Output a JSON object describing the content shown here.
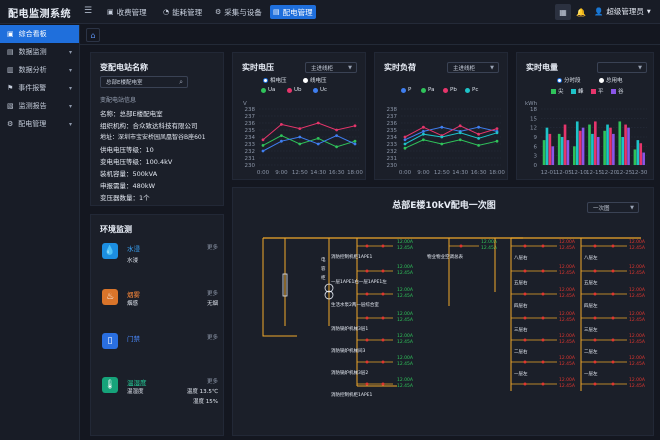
{
  "app": {
    "title": "配电监测系统",
    "user": "超级管理员"
  },
  "topnav": [
    {
      "icon": "billing-icon",
      "label": "收费管理",
      "active": false
    },
    {
      "icon": "energy-icon",
      "label": "能耗管理",
      "active": false
    },
    {
      "icon": "device-icon",
      "label": "采集与设备",
      "active": false
    },
    {
      "icon": "distribution-icon",
      "label": "配电管理",
      "active": true
    }
  ],
  "sidebar": [
    {
      "label": "综合看板",
      "active": true,
      "has_arrow": false
    },
    {
      "label": "数据监测",
      "active": false,
      "has_arrow": true
    },
    {
      "label": "数据分析",
      "active": false,
      "has_arrow": true
    },
    {
      "label": "事件报警",
      "active": false,
      "has_arrow": true
    },
    {
      "label": "监测报告",
      "active": false,
      "has_arrow": true
    },
    {
      "label": "配电管理",
      "active": false,
      "has_arrow": true
    }
  ],
  "station": {
    "title": "变配电站名称",
    "selected": "总部E楼配电室",
    "info_title": "变配电站信息",
    "lines": [
      "名称：总部E楼配电室",
      "组织机构：合众致达科技有限公司",
      "地址：深圳市宝安桥园凤凰智谷B座601",
      "供电电压等级：10",
      "变电电压等级：100.4kV",
      "装机容量：500kVA",
      "申报需量：480kW",
      "变压器数量：1个"
    ]
  },
  "environment": {
    "title": "环境监测",
    "items": [
      {
        "icon": "water-icon",
        "name": "水浸",
        "color": "#1c8ee0",
        "name_color": "#3aa8ff",
        "more": "更多",
        "sub": "水浸",
        "value": ""
      },
      {
        "icon": "smoke-icon",
        "name": "烟雾",
        "color": "#d9742a",
        "name_color": "#ff8a3a",
        "more": "更多",
        "sub": "烟感",
        "value": "无烟"
      },
      {
        "icon": "door-icon",
        "name": "门禁",
        "color": "#2a6fe0",
        "name_color": "#4a8aff",
        "more": "更多",
        "sub": "",
        "value": ""
      },
      {
        "icon": "thermometer-icon",
        "name": "温湿度",
        "color": "#16a37a",
        "name_color": "#25d09a",
        "more": "更多",
        "sub": "温湿度",
        "value": "温度 13.5℃",
        "value2": "湿度 15%"
      }
    ]
  },
  "voltage": {
    "title": "实时电压",
    "select": "主进线柜",
    "radio": [
      "相电压",
      "线电压"
    ],
    "legend": [
      {
        "name": "Ua",
        "color": "#2fc35a"
      },
      {
        "name": "Ub",
        "color": "#e6356b"
      },
      {
        "name": "Uc",
        "color": "#3f7ef0"
      }
    ],
    "unit": "V"
  },
  "load": {
    "title": "实时负荷",
    "select": "主进线柜",
    "legend": [
      {
        "name": "P",
        "color": "#3f7ef0"
      },
      {
        "name": "Pa",
        "color": "#2fc35a"
      },
      {
        "name": "Pb",
        "color": "#e6356b"
      },
      {
        "name": "Pc",
        "color": "#1ec3c8"
      }
    ]
  },
  "energy": {
    "title": "实时电量",
    "select": "",
    "radio": [
      "分时段",
      "总用电"
    ],
    "legend": [
      {
        "name": "尖",
        "color": "#2fc35a"
      },
      {
        "name": "峰",
        "color": "#1ec3c8"
      },
      {
        "name": "平",
        "color": "#e6356b"
      },
      {
        "name": "谷",
        "color": "#8a55e8"
      }
    ],
    "unit": "kWh"
  },
  "diagram": {
    "title": "总部E楼10kV配电一次图",
    "select": "一次图"
  },
  "chart_data": [
    {
      "type": "line",
      "title": "实时电压",
      "ylabel": "V",
      "x": [
        "0:00",
        "9:00",
        "12:50",
        "14:30",
        "16:30",
        "18:00"
      ],
      "ylim": [
        230,
        238
      ],
      "yticks": [
        230,
        231,
        232,
        233,
        234,
        235,
        236,
        237,
        238
      ],
      "series": [
        {
          "name": "Ua",
          "color": "#2fc35a",
          "values": [
            232.8,
            234.2,
            233.0,
            233.8,
            232.6,
            233.4
          ]
        },
        {
          "name": "Ub",
          "color": "#e6356b",
          "values": [
            233.6,
            235.8,
            235.2,
            236.0,
            235.0,
            235.6
          ]
        },
        {
          "name": "Uc",
          "color": "#3f7ef0",
          "values": [
            232.0,
            233.4,
            234.0,
            233.0,
            234.2,
            233.0
          ]
        }
      ]
    },
    {
      "type": "line",
      "title": "实时负荷",
      "ylabel": "",
      "x": [
        "0:00",
        "9:00",
        "12:50",
        "14:30",
        "16:30",
        "18:00"
      ],
      "ylim": [
        230,
        238
      ],
      "yticks": [
        230,
        231,
        232,
        233,
        234,
        235,
        236,
        237,
        238
      ],
      "series": [
        {
          "name": "P",
          "color": "#3f7ef0",
          "values": [
            233.6,
            234.8,
            235.4,
            234.8,
            235.4,
            234.8
          ]
        },
        {
          "name": "Pa",
          "color": "#2fc35a",
          "values": [
            232.4,
            233.6,
            233.0,
            233.6,
            232.8,
            233.4
          ]
        },
        {
          "name": "Pb",
          "color": "#e6356b",
          "values": [
            234.0,
            235.4,
            234.2,
            235.6,
            234.4,
            235.2
          ]
        },
        {
          "name": "Pc",
          "color": "#1ec3c8",
          "values": [
            233.0,
            234.4,
            234.0,
            234.6,
            233.8,
            234.6
          ]
        }
      ]
    },
    {
      "type": "bar",
      "title": "实时电量",
      "ylabel": "kWh",
      "categories": [
        "12-01",
        "12-05",
        "12-10",
        "12-15",
        "12-20",
        "12-25",
        "12-30"
      ],
      "ylim": [
        0,
        18
      ],
      "yticks": [
        0,
        3,
        6,
        9,
        12,
        15,
        18
      ],
      "series": [
        {
          "name": "尖",
          "color": "#2fc35a",
          "values": [
            8,
            10,
            6,
            13,
            11,
            14,
            5
          ]
        },
        {
          "name": "峰",
          "color": "#1ec3c8",
          "values": [
            12,
            9,
            14,
            10,
            13,
            9,
            8
          ]
        },
        {
          "name": "平",
          "color": "#e6356b",
          "values": [
            10,
            13,
            11,
            14,
            12,
            13,
            7
          ]
        },
        {
          "name": "谷",
          "color": "#8a55e8",
          "values": [
            6,
            8,
            12,
            9,
            10,
            12,
            4
          ]
        }
      ]
    }
  ],
  "single_line": {
    "left_vertical": [
      "电容柜",
      "主进线柜"
    ],
    "col1": [
      "消防控制机柜1APE1",
      "一层1APE1右一层1APE1左",
      "生活水泵2两一层综合室",
      "消防锅炉机械3层1",
      "消防锅炉机械间3",
      "消防锅炉机械3层2"
    ],
    "col2_mid": "物业物业空调总表",
    "right_labels": [
      "八层右",
      "五层右",
      "四层右",
      "三层右",
      "二层右",
      "一层左"
    ],
    "right_labels2": [
      "八层左",
      "五层左",
      "四层左",
      "三层左",
      "二层左",
      "一层左"
    ],
    "readings": [
      "12.00A",
      "12.45A"
    ]
  }
}
